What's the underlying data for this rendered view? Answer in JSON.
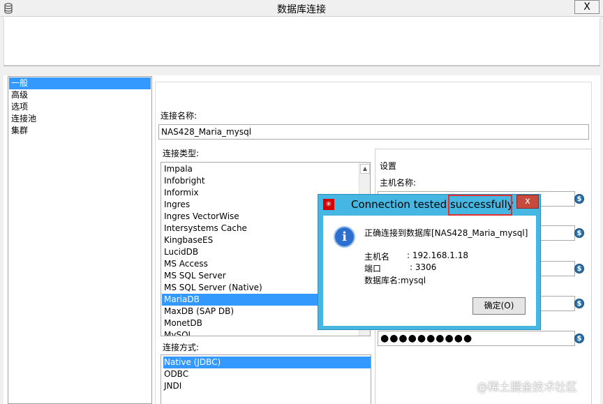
{
  "window": {
    "title": "数据库连接",
    "close_label": "X"
  },
  "categories": [
    {
      "label": "一般",
      "selected": true
    },
    {
      "label": "高级",
      "selected": false
    },
    {
      "label": "选项",
      "selected": false
    },
    {
      "label": "连接池",
      "selected": false
    },
    {
      "label": "集群",
      "selected": false
    }
  ],
  "connection": {
    "name_label": "连接名称:",
    "name_value": "NAS428_Maria_mysql",
    "type_label": "连接类型:",
    "types": [
      "Impala",
      "Infobright",
      "Informix",
      "Ingres",
      "Ingres VectorWise",
      "Intersystems Cache",
      "KingbaseES",
      "LucidDB",
      "MS Access",
      "MS SQL Server",
      "MS SQL Server (Native)",
      "MariaDB",
      "MaxDB (SAP DB)",
      "MonetDB",
      "MySQL"
    ],
    "selected_type": "MariaDB",
    "access_label": "连接方式:",
    "access_methods": [
      "Native (JDBC)",
      "ODBC",
      "JNDI"
    ],
    "selected_access": "Native (JDBC)"
  },
  "settings": {
    "group_label": "设置",
    "host_label": "主机名称:",
    "password_mask": "●●●●●●●●●●",
    "var_icon": "$"
  },
  "dialog": {
    "title_part1": "Connection tested ",
    "title_part2": "successfully",
    "close_label": "x",
    "message": "正确连接到数据库[NAS428_Maria_mysql]",
    "host_key": "主机名",
    "host_value": ": 192.168.1.18",
    "port_key": "端口",
    "port_value": ": 3306",
    "db_line": "数据库名:mysql",
    "ok_label": "确定(O)",
    "info_icon": "i"
  },
  "watermark": "@稀土掘金技术社区",
  "colors": {
    "selection": "#3399ff",
    "dialog_frame": "#46b7e2",
    "highlight_box": "#e03030",
    "close_red": "#c74a3c"
  }
}
